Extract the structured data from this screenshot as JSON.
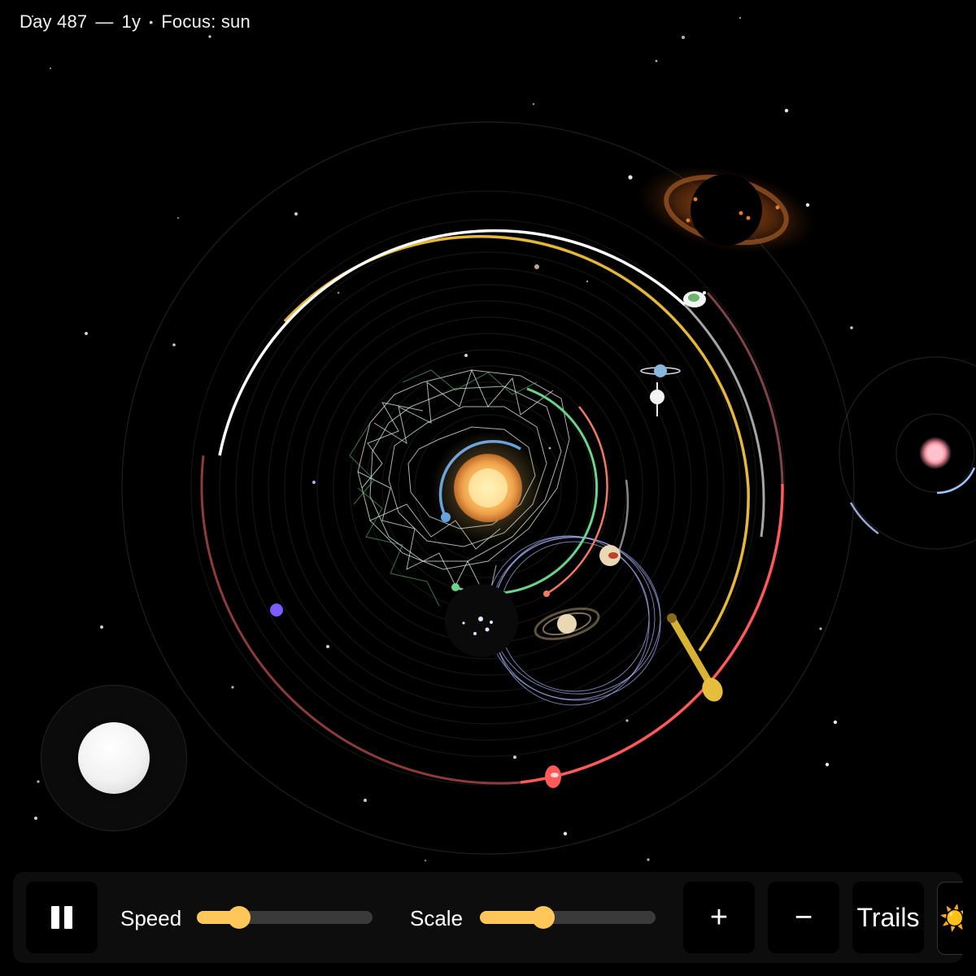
{
  "hud": {
    "day": "Day 487",
    "dash": "—",
    "elapsed": "1y",
    "separator": "•",
    "focus": "Focus: sun"
  },
  "toolbar": {
    "pause_icon": "pause-icon",
    "speed_label": "Speed",
    "speed_value": 0.24,
    "scale_label": "Scale",
    "scale_value": 0.36,
    "zoom_in_label": "+",
    "zoom_out_label": "−",
    "trails_label": "Trails",
    "focus_icon": "☀️",
    "accent": "#ffc65a"
  },
  "scene": {
    "background": "#000000",
    "sun_color": "#ffd27a",
    "companion_star_color": "#ff9aa8",
    "black_hole_glow": "#a0461c"
  }
}
